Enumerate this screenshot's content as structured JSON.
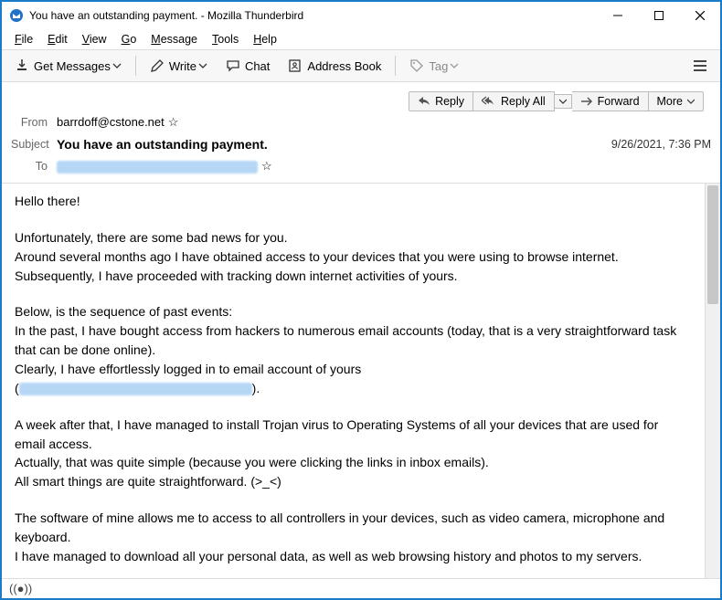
{
  "window": {
    "title": "You have an outstanding payment. - Mozilla Thunderbird"
  },
  "menubar": {
    "file": "File",
    "edit": "Edit",
    "view": "View",
    "go": "Go",
    "message": "Message",
    "tools": "Tools",
    "help": "Help"
  },
  "toolbar": {
    "getmessages": "Get Messages",
    "write": "Write",
    "chat": "Chat",
    "addressbook": "Address Book",
    "tag": "Tag"
  },
  "headers": {
    "from_label": "From",
    "from_value": "barrdoff@cstone.net",
    "subject_label": "Subject",
    "subject_value": "You have an outstanding payment.",
    "to_label": "To",
    "date": "9/26/2021, 7:36 PM"
  },
  "actions": {
    "reply": "Reply",
    "replyall": "Reply All",
    "forward": "Forward",
    "more": "More"
  },
  "body": {
    "p1": "Hello there!",
    "p2": "Unfortunately, there are some bad news for you.\nAround several months ago I have obtained access to your devices that you were using to browse internet.\nSubsequently, I have proceeded with tracking down internet activities of yours.",
    "p3": "Below, is the sequence of past events:\nIn the past, I have bought access from hackers to numerous email accounts (today, that is a very straightforward task that can be done online).\nClearly, I have effortlessly logged in to email account of yours\n(",
    "p3b": ").",
    "p4": "A week after that, I have managed to install Trojan virus to Operating Systems of all your devices that are used for email access.\nActually, that was quite simple (because you were clicking the links in inbox emails).\nAll smart things are quite straightforward. (>_<)",
    "p5": "The software of mine allows me to access to all controllers in your devices, such as video camera, microphone and keyboard.\nI have managed to download all your personal data, as well as web browsing history and photos to my servers."
  }
}
